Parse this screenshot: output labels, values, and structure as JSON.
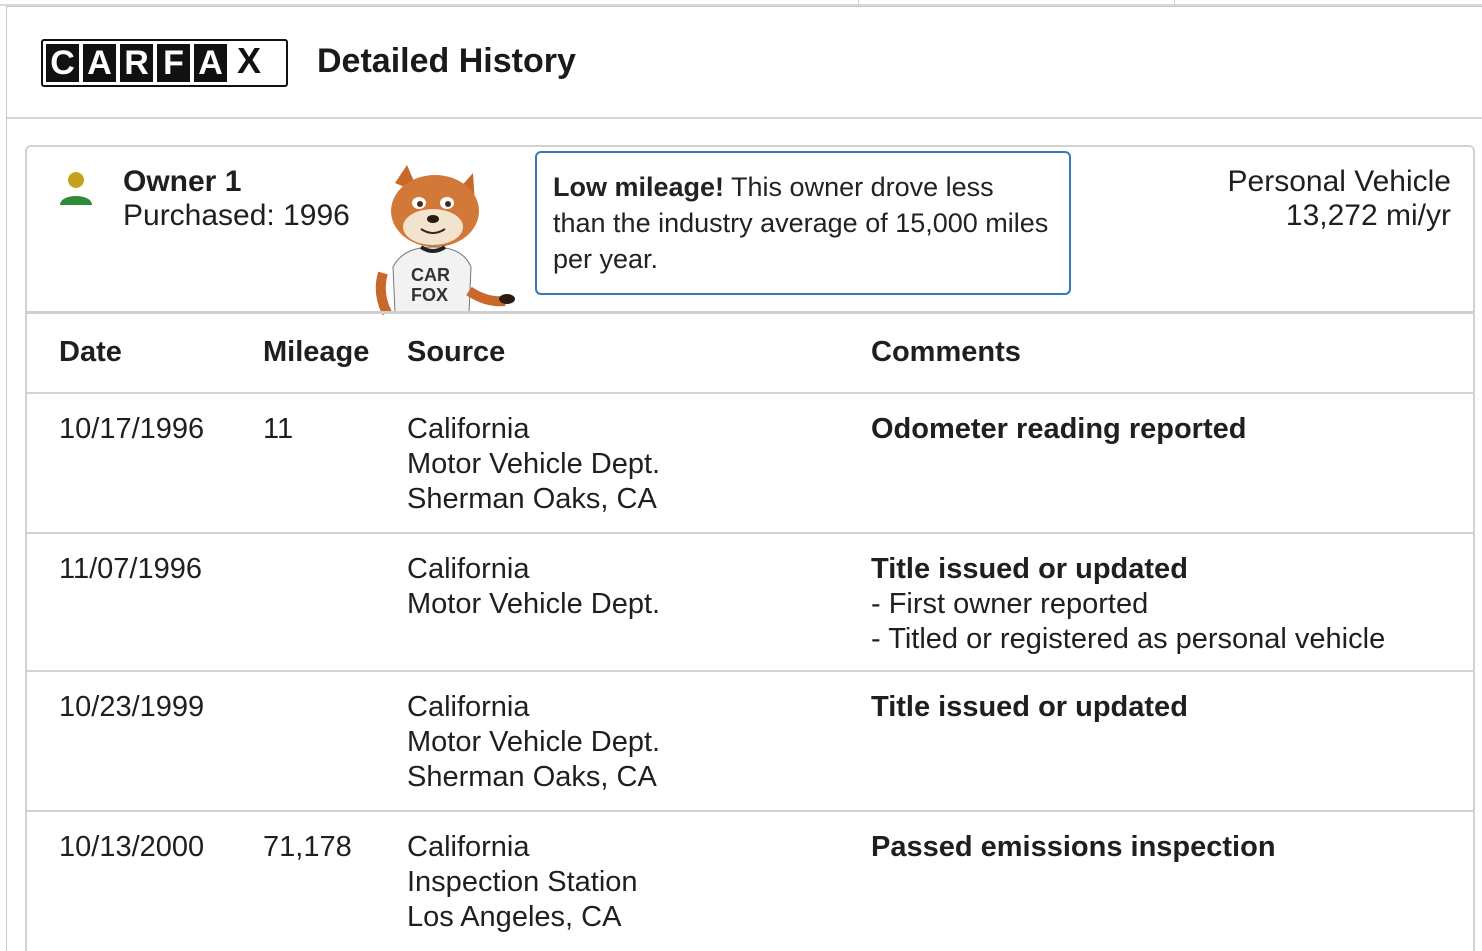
{
  "header": {
    "title": "Detailed History",
    "logo_letters": [
      "C",
      "A",
      "R",
      "F",
      "A",
      "X"
    ]
  },
  "owner": {
    "label": "Owner 1",
    "purchased": "Purchased: 1996",
    "icon": "person-icon"
  },
  "callout": {
    "bold": "Low mileage!",
    "text": " This owner drove less than the industry average of 15,000 miles per year."
  },
  "vehicle": {
    "type": "Personal Vehicle",
    "mileage_per_year": "13,272 mi/yr"
  },
  "mascot": {
    "shirt_line1": "CAR",
    "shirt_line2": "FOX"
  },
  "table": {
    "headers": {
      "date": "Date",
      "mileage": "Mileage",
      "source": "Source",
      "comments": "Comments"
    },
    "rows": [
      {
        "date": "10/17/1996",
        "mileage": "11",
        "source": [
          "California",
          "Motor Vehicle Dept.",
          "Sherman Oaks, CA"
        ],
        "comment_title": "Odometer reading reported",
        "comment_items": []
      },
      {
        "date": "11/07/1996",
        "mileage": "",
        "source": [
          "California",
          "Motor Vehicle Dept."
        ],
        "comment_title": "Title issued or updated",
        "comment_items": [
          "- First owner reported",
          "- Titled or registered as personal vehicle"
        ]
      },
      {
        "date": "10/23/1999",
        "mileage": "",
        "source": [
          "California",
          "Motor Vehicle Dept.",
          "Sherman Oaks, CA"
        ],
        "comment_title": "Title issued or updated",
        "comment_items": []
      },
      {
        "date": "10/13/2000",
        "mileage": "71,178",
        "source": [
          "California",
          "Inspection Station",
          "Los Angeles, CA"
        ],
        "comment_title": "Passed emissions inspection",
        "comment_items": []
      }
    ]
  },
  "colors": {
    "callout_border": "#3777bc",
    "icon_head": "#c8a020",
    "icon_body": "#2e8b3a"
  }
}
